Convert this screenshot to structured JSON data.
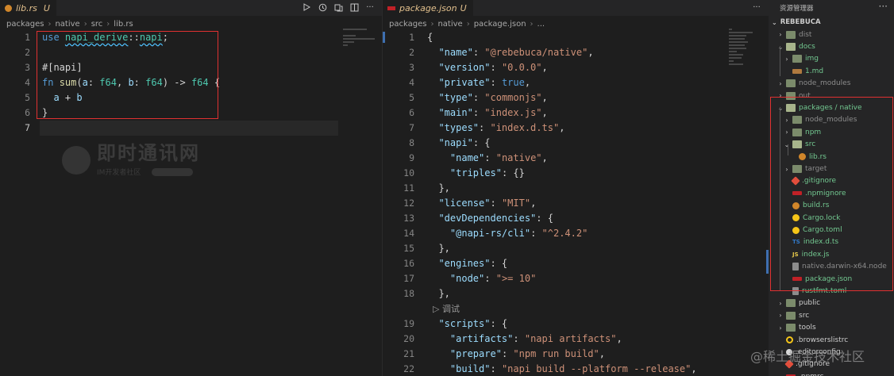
{
  "left_editor": {
    "tab": {
      "filename": "lib.rs",
      "status": "U"
    },
    "breadcrumb": [
      "packages",
      "native",
      "src",
      "lib.rs"
    ],
    "lines": [
      {
        "n": "1",
        "segments": [
          [
            "kw",
            "use "
          ],
          [
            "sq",
            "napi_derive"
          ],
          [
            "pu",
            "::"
          ],
          [
            "sq",
            "napi"
          ],
          [
            "pu",
            ";"
          ]
        ]
      },
      {
        "n": "2",
        "segments": []
      },
      {
        "n": "3",
        "segments": [
          [
            "attr",
            "#[napi]"
          ]
        ]
      },
      {
        "n": "4",
        "segments": [
          [
            "kw",
            "fn "
          ],
          [
            "fn",
            "sum"
          ],
          [
            "pu",
            "("
          ],
          [
            "va",
            "a"
          ],
          [
            "pu",
            ": "
          ],
          [
            "ty",
            "f64"
          ],
          [
            "pu",
            ", "
          ],
          [
            "va",
            "b"
          ],
          [
            "pu",
            ": "
          ],
          [
            "ty",
            "f64"
          ],
          [
            "pu",
            ") "
          ],
          [
            "op",
            "-> "
          ],
          [
            "ty",
            "f64"
          ],
          [
            "pu",
            " {"
          ]
        ]
      },
      {
        "n": "5",
        "segments": [
          [
            "pu",
            "  "
          ],
          [
            "va",
            "a"
          ],
          [
            "op",
            " + "
          ],
          [
            "va",
            "b"
          ]
        ]
      },
      {
        "n": "6",
        "segments": [
          [
            "pu",
            "}"
          ]
        ]
      },
      {
        "n": "7",
        "segments": []
      }
    ],
    "current_line": "7"
  },
  "right_editor": {
    "tab": {
      "filename": "package.json",
      "status": "U"
    },
    "breadcrumb": [
      "packages",
      "native",
      "package.json",
      "..."
    ],
    "lines": [
      {
        "n": "1",
        "segments": [
          [
            "pu",
            "{"
          ]
        ]
      },
      {
        "n": "2",
        "segments": [
          [
            "pu",
            "  "
          ],
          [
            "va",
            "\"name\""
          ],
          [
            "pu",
            ": "
          ],
          [
            "st",
            "\"@rebebuca/native\""
          ],
          [
            "pu",
            ","
          ]
        ]
      },
      {
        "n": "3",
        "segments": [
          [
            "pu",
            "  "
          ],
          [
            "va",
            "\"version\""
          ],
          [
            "pu",
            ": "
          ],
          [
            "st",
            "\"0.0.0\""
          ],
          [
            "pu",
            ","
          ]
        ]
      },
      {
        "n": "4",
        "segments": [
          [
            "pu",
            "  "
          ],
          [
            "va",
            "\"private\""
          ],
          [
            "pu",
            ": "
          ],
          [
            "kw",
            "true"
          ],
          [
            "pu",
            ","
          ]
        ]
      },
      {
        "n": "5",
        "segments": [
          [
            "pu",
            "  "
          ],
          [
            "va",
            "\"type\""
          ],
          [
            "pu",
            ": "
          ],
          [
            "st",
            "\"commonjs\""
          ],
          [
            "pu",
            ","
          ]
        ]
      },
      {
        "n": "6",
        "segments": [
          [
            "pu",
            "  "
          ],
          [
            "va",
            "\"main\""
          ],
          [
            "pu",
            ": "
          ],
          [
            "st",
            "\"index.js\""
          ],
          [
            "pu",
            ","
          ]
        ]
      },
      {
        "n": "7",
        "segments": [
          [
            "pu",
            "  "
          ],
          [
            "va",
            "\"types\""
          ],
          [
            "pu",
            ": "
          ],
          [
            "st",
            "\"index.d.ts\""
          ],
          [
            "pu",
            ","
          ]
        ]
      },
      {
        "n": "8",
        "segments": [
          [
            "pu",
            "  "
          ],
          [
            "va",
            "\"napi\""
          ],
          [
            "pu",
            ": {"
          ]
        ]
      },
      {
        "n": "9",
        "segments": [
          [
            "pu",
            "    "
          ],
          [
            "va",
            "\"name\""
          ],
          [
            "pu",
            ": "
          ],
          [
            "st",
            "\"native\""
          ],
          [
            "pu",
            ","
          ]
        ]
      },
      {
        "n": "10",
        "segments": [
          [
            "pu",
            "    "
          ],
          [
            "va",
            "\"triples\""
          ],
          [
            "pu",
            ": {}"
          ]
        ]
      },
      {
        "n": "11",
        "segments": [
          [
            "pu",
            "  },"
          ]
        ]
      },
      {
        "n": "12",
        "segments": [
          [
            "pu",
            "  "
          ],
          [
            "va",
            "\"license\""
          ],
          [
            "pu",
            ": "
          ],
          [
            "st",
            "\"MIT\""
          ],
          [
            "pu",
            ","
          ]
        ]
      },
      {
        "n": "13",
        "segments": [
          [
            "pu",
            "  "
          ],
          [
            "va",
            "\"devDependencies\""
          ],
          [
            "pu",
            ": {"
          ]
        ]
      },
      {
        "n": "14",
        "segments": [
          [
            "pu",
            "    "
          ],
          [
            "va",
            "\"@napi-rs/cli\""
          ],
          [
            "pu",
            ": "
          ],
          [
            "st",
            "\"^2.4.2\""
          ]
        ]
      },
      {
        "n": "15",
        "segments": [
          [
            "pu",
            "  },"
          ]
        ]
      },
      {
        "n": "16",
        "segments": [
          [
            "pu",
            "  "
          ],
          [
            "va",
            "\"engines\""
          ],
          [
            "pu",
            ": {"
          ]
        ]
      },
      {
        "n": "17",
        "segments": [
          [
            "pu",
            "    "
          ],
          [
            "va",
            "\"node\""
          ],
          [
            "pu",
            ": "
          ],
          [
            "st",
            "\">= 10\""
          ]
        ]
      },
      {
        "n": "18",
        "segments": [
          [
            "pu",
            "  },"
          ]
        ]
      },
      {
        "n": "",
        "segments": [
          [
            "lens",
            "  ▷ 调试"
          ]
        ]
      },
      {
        "n": "19",
        "segments": [
          [
            "pu",
            "  "
          ],
          [
            "va",
            "\"scripts\""
          ],
          [
            "pu",
            ": {"
          ]
        ]
      },
      {
        "n": "20",
        "segments": [
          [
            "pu",
            "    "
          ],
          [
            "va",
            "\"artifacts\""
          ],
          [
            "pu",
            ": "
          ],
          [
            "st",
            "\"napi artifacts\""
          ],
          [
            "pu",
            ","
          ]
        ]
      },
      {
        "n": "21",
        "segments": [
          [
            "pu",
            "    "
          ],
          [
            "va",
            "\"prepare\""
          ],
          [
            "pu",
            ": "
          ],
          [
            "st",
            "\"npm run build\""
          ],
          [
            "pu",
            ","
          ]
        ]
      },
      {
        "n": "22",
        "segments": [
          [
            "pu",
            "    "
          ],
          [
            "va",
            "\"build\""
          ],
          [
            "pu",
            ": "
          ],
          [
            "st",
            "\"napi build --platform --release\""
          ],
          [
            "pu",
            ","
          ]
        ]
      }
    ]
  },
  "explorer": {
    "title": "资源管理器",
    "root": "REBEBUCA",
    "items": [
      {
        "label": "dist",
        "depth": 1,
        "kind": "folder",
        "color": "c-gray",
        "chev": "›"
      },
      {
        "label": "docs",
        "depth": 1,
        "kind": "folder open",
        "color": "c-green",
        "chev": "⌄"
      },
      {
        "label": "img",
        "depth": 2,
        "kind": "folder",
        "color": "c-green",
        "chev": "›"
      },
      {
        "label": "1.md",
        "depth": 2,
        "kind": "file-md",
        "color": "c-green",
        "chev": ""
      },
      {
        "label": "node_modules",
        "depth": 1,
        "kind": "folder",
        "color": "c-gray",
        "chev": "›"
      },
      {
        "label": "out",
        "depth": 1,
        "kind": "folder",
        "color": "c-gray",
        "chev": "›"
      },
      {
        "label": "packages / native",
        "depth": 1,
        "kind": "folder open",
        "color": "c-green",
        "chev": "⌄"
      },
      {
        "label": "node_modules",
        "depth": 2,
        "kind": "folder",
        "color": "c-gray",
        "chev": "›"
      },
      {
        "label": "npm",
        "depth": 2,
        "kind": "folder",
        "color": "c-green",
        "chev": "›"
      },
      {
        "label": "src",
        "depth": 2,
        "kind": "folder open",
        "color": "c-green",
        "chev": "⌄"
      },
      {
        "label": "lib.rs",
        "depth": 3,
        "kind": "file-rs",
        "color": "c-green",
        "chev": ""
      },
      {
        "label": "target",
        "depth": 2,
        "kind": "folder",
        "color": "c-gray",
        "chev": "›"
      },
      {
        "label": ".gitignore",
        "depth": 2,
        "kind": "file-git",
        "color": "c-green",
        "chev": ""
      },
      {
        "label": ".npmignore",
        "depth": 2,
        "kind": "file-npm",
        "color": "c-green",
        "chev": ""
      },
      {
        "label": "build.rs",
        "depth": 2,
        "kind": "file-rs",
        "color": "c-green",
        "chev": ""
      },
      {
        "label": "Cargo.lock",
        "depth": 2,
        "kind": "file-lock",
        "color": "c-green",
        "chev": ""
      },
      {
        "label": "Cargo.toml",
        "depth": 2,
        "kind": "file-lock",
        "color": "c-green",
        "chev": ""
      },
      {
        "label": "index.d.ts",
        "depth": 2,
        "kind": "file-ts",
        "color": "c-green",
        "chev": ""
      },
      {
        "label": "index.js",
        "depth": 2,
        "kind": "file-js",
        "color": "c-green",
        "chev": ""
      },
      {
        "label": "native.darwin-x64.node",
        "depth": 2,
        "kind": "file-txt",
        "color": "c-gray",
        "chev": ""
      },
      {
        "label": "package.json",
        "depth": 2,
        "kind": "file-json",
        "color": "c-green",
        "chev": ""
      },
      {
        "label": "rustfmt.toml",
        "depth": 2,
        "kind": "file-txt",
        "color": "c-green",
        "chev": ""
      },
      {
        "label": "public",
        "depth": 1,
        "kind": "folder",
        "color": "c-white",
        "chev": "›"
      },
      {
        "label": "src",
        "depth": 1,
        "kind": "folder",
        "color": "c-white",
        "chev": "›"
      },
      {
        "label": "tools",
        "depth": 1,
        "kind": "folder",
        "color": "c-white",
        "chev": "›"
      },
      {
        "label": ".browserslistrc",
        "depth": 1,
        "kind": "file-brw",
        "color": "c-white",
        "chev": ""
      },
      {
        "label": ".editorconfig",
        "depth": 1,
        "kind": "file-cfg",
        "color": "c-white",
        "chev": ""
      },
      {
        "label": ".gitignore",
        "depth": 1,
        "kind": "file-git",
        "color": "c-white",
        "chev": ""
      },
      {
        "label": ".npmrc",
        "depth": 1,
        "kind": "file-npm",
        "color": "c-white",
        "chev": ""
      }
    ]
  },
  "watermarks": {
    "logo_title": "即时通讯网",
    "logo_sub": "IM开发者社区",
    "corner": "@稀土掘金技术社区"
  },
  "colors": {
    "highlight_box": "#e03131",
    "modified": "#e2c08d",
    "untracked": "#73c991"
  }
}
